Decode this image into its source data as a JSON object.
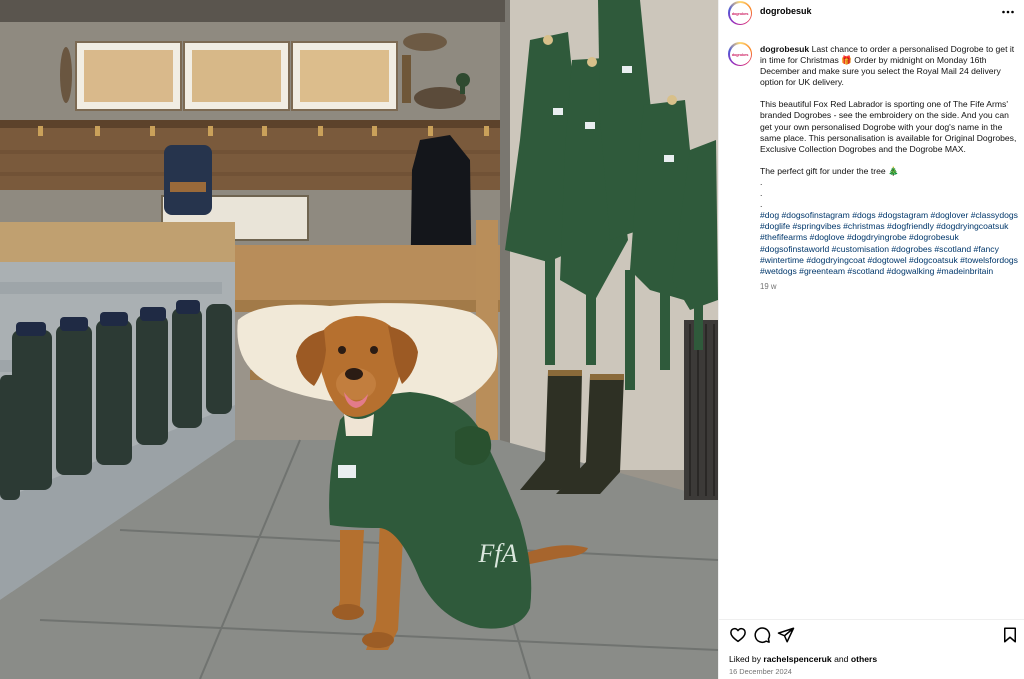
{
  "post": {
    "username": "dogrobesuk",
    "avatar_text": "dogrobes",
    "photo_alt": "Fox Red Labrador wearing a green Dogrobe in a boot room",
    "embroidery": "FfA"
  },
  "caption": {
    "username": "dogrobesuk",
    "line1": "Last chance to order a personalised Dogrobe to get it in time for Christmas 🎁 Order by midnight on Monday 16th December and make sure you select the Royal Mail 24 delivery option for UK delivery.",
    "line2": "This beautiful Fox Red Labrador is sporting one of The Fife Arms' branded Dogrobes - see the embroidery on the side. And you can get your own personalised Dogrobe with your dog's name in the same place. This personalisation is available for Original Dogrobes, Exclusive Collection Dogrobes and the Dogrobe MAX.",
    "line3": "The perfect gift for under the tree 🎄",
    "dot1": ".",
    "dot2": ".",
    "dot3": ".",
    "hashtags": "#dog #dogsofinstagram #dogs #dogstagram #doglover #classydogs #doglife #springvibes #christmas #dogfriendly #dogdryingcoatsuk #thefifearms #doglove #dogdryingrobe #dogrobesuk #dogsofinstaworld #customisation #dogrobes #scotland #fancy #wintertime #dogdryingcoat #dogtowel #dogcoatsuk #towelsfordogs #wetdogs #greenteam #scotland #dogwalking #madeinbritain",
    "time_ago": "19 w"
  },
  "footer": {
    "liked_prefix": "Liked by",
    "liked_user": "rachelspenceruk",
    "liked_and": "and",
    "liked_others": "others",
    "date": "16 December 2024"
  },
  "icons": {
    "more": "more-options-icon",
    "like": "heart-icon",
    "comment": "comment-icon",
    "share": "share-icon",
    "save": "bookmark-icon"
  },
  "colors": {
    "link": "#00376b",
    "muted": "#737373",
    "robe_green": "#2f5a3b"
  }
}
